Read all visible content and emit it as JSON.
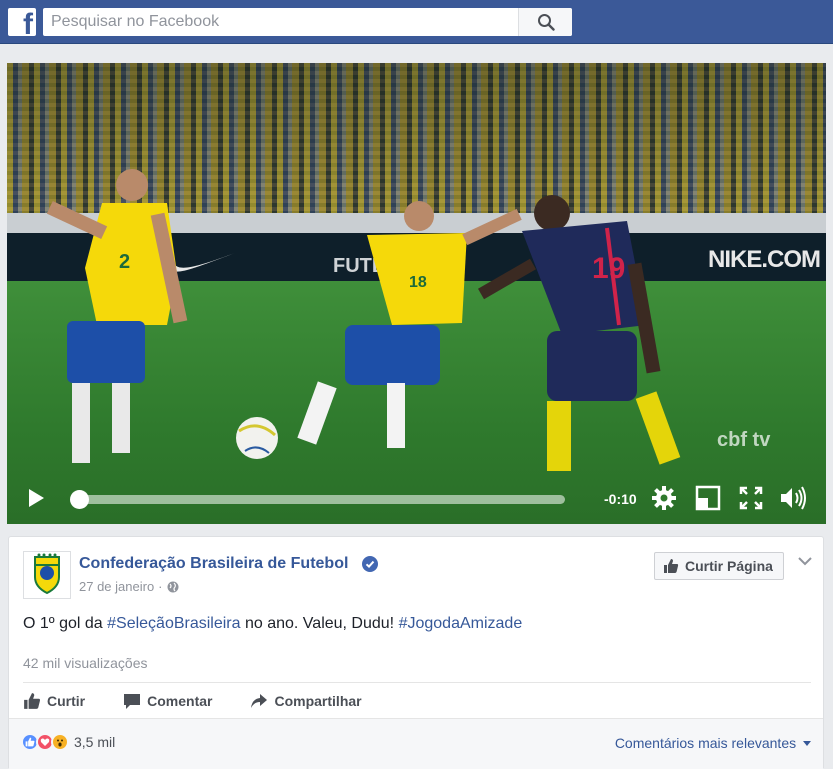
{
  "header": {
    "logo_letter": "f",
    "search_placeholder": "Pesquisar no Facebook"
  },
  "video": {
    "time_remaining": "-0:10",
    "progress": 0.0,
    "overlay": {
      "board_text": "NIKE.COM",
      "board_text_2": "FUTEBOL",
      "watermark": "cbf tv",
      "jersey_left": "2",
      "jersey_mid": "18",
      "jersey_right": "19"
    }
  },
  "post": {
    "page_name": "Confederação Brasileira de Futebol",
    "date": "27 de janeiro",
    "like_page_label": "Curtir Página",
    "text_before": "O 1º gol da ",
    "hashtag_1": "#SeleçãoBrasileira",
    "text_middle": " no ano. Valeu, Dudu! ",
    "hashtag_2": "#JogodaAmizade",
    "views": "42 mil visualizações",
    "actions": {
      "like": "Curtir",
      "comment": "Comentar",
      "share": "Compartilhar"
    },
    "reaction_count": "3,5 mil",
    "comments_sort": "Comentários mais relevantes",
    "avatar_text": "BRASIL"
  },
  "colors": {
    "facebook_blue": "#3b5998",
    "link_blue": "#365899",
    "brazil_yellow": "#f5d90a",
    "brazil_blue": "#1d4fa8",
    "colombia_navy": "#1f2a5a"
  }
}
